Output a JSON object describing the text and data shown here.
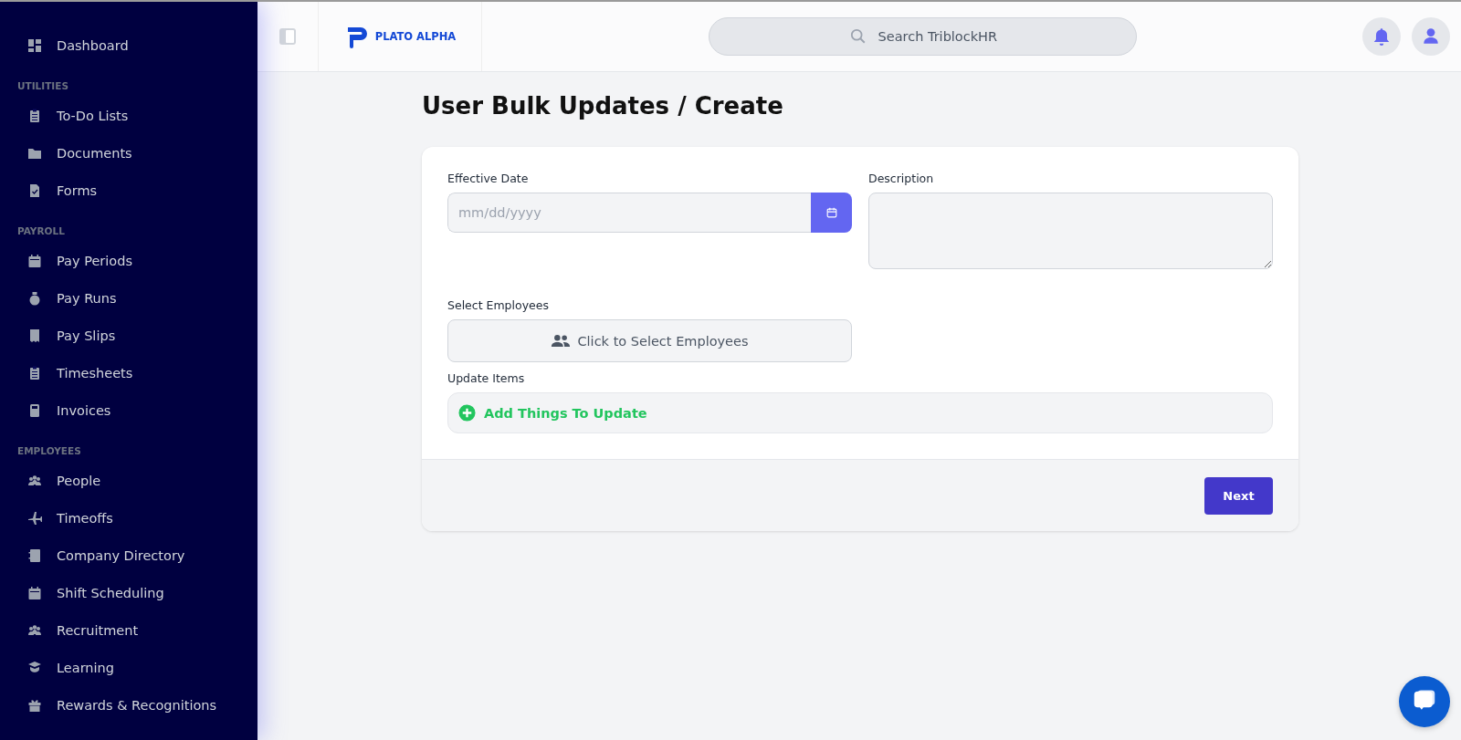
{
  "sidebar": {
    "sections": [
      {
        "items": [
          {
            "label": "Dashboard"
          }
        ]
      },
      {
        "heading": "UTILITIES",
        "items": [
          {
            "label": "To-Do Lists"
          },
          {
            "label": "Documents"
          },
          {
            "label": "Forms"
          }
        ]
      },
      {
        "heading": "PAYROLL",
        "items": [
          {
            "label": "Pay Periods"
          },
          {
            "label": "Pay Runs"
          },
          {
            "label": "Pay Slips"
          },
          {
            "label": "Timesheets"
          },
          {
            "label": "Invoices"
          }
        ]
      },
      {
        "heading": "EMPLOYEES",
        "items": [
          {
            "label": "People"
          },
          {
            "label": "Timeoffs"
          },
          {
            "label": "Company Directory"
          },
          {
            "label": "Shift Scheduling"
          },
          {
            "label": "Recruitment"
          },
          {
            "label": "Learning"
          },
          {
            "label": "Rewards & Recognitions"
          }
        ]
      }
    ]
  },
  "header": {
    "logo_text": "PLATO ALPHA",
    "search": {
      "placeholder": "Search TriblockHR"
    }
  },
  "page": {
    "title": "User Bulk Updates / Create",
    "form": {
      "effective_date": {
        "label": "Effective Date",
        "placeholder": "mm/dd/yyyy"
      },
      "description": {
        "label": "Description"
      },
      "select_employees": {
        "label": "Select Employees",
        "button": "Click to Select Employees"
      },
      "update_items": {
        "label": "Update Items",
        "add": "Add Things To Update"
      }
    },
    "buttons": [
      "Next"
    ]
  }
}
